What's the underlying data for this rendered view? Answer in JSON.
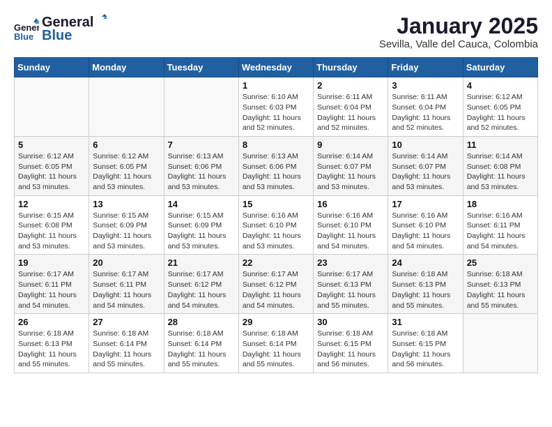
{
  "header": {
    "logo_line1": "General",
    "logo_line2": "Blue",
    "month": "January 2025",
    "location": "Sevilla, Valle del Cauca, Colombia"
  },
  "days_of_week": [
    "Sunday",
    "Monday",
    "Tuesday",
    "Wednesday",
    "Thursday",
    "Friday",
    "Saturday"
  ],
  "weeks": [
    [
      {
        "day": "",
        "info": ""
      },
      {
        "day": "",
        "info": ""
      },
      {
        "day": "",
        "info": ""
      },
      {
        "day": "1",
        "info": "Sunrise: 6:10 AM\nSunset: 6:03 PM\nDaylight: 11 hours\nand 52 minutes."
      },
      {
        "day": "2",
        "info": "Sunrise: 6:11 AM\nSunset: 6:04 PM\nDaylight: 11 hours\nand 52 minutes."
      },
      {
        "day": "3",
        "info": "Sunrise: 6:11 AM\nSunset: 6:04 PM\nDaylight: 11 hours\nand 52 minutes."
      },
      {
        "day": "4",
        "info": "Sunrise: 6:12 AM\nSunset: 6:05 PM\nDaylight: 11 hours\nand 52 minutes."
      }
    ],
    [
      {
        "day": "5",
        "info": "Sunrise: 6:12 AM\nSunset: 6:05 PM\nDaylight: 11 hours\nand 53 minutes."
      },
      {
        "day": "6",
        "info": "Sunrise: 6:12 AM\nSunset: 6:05 PM\nDaylight: 11 hours\nand 53 minutes."
      },
      {
        "day": "7",
        "info": "Sunrise: 6:13 AM\nSunset: 6:06 PM\nDaylight: 11 hours\nand 53 minutes."
      },
      {
        "day": "8",
        "info": "Sunrise: 6:13 AM\nSunset: 6:06 PM\nDaylight: 11 hours\nand 53 minutes."
      },
      {
        "day": "9",
        "info": "Sunrise: 6:14 AM\nSunset: 6:07 PM\nDaylight: 11 hours\nand 53 minutes."
      },
      {
        "day": "10",
        "info": "Sunrise: 6:14 AM\nSunset: 6:07 PM\nDaylight: 11 hours\nand 53 minutes."
      },
      {
        "day": "11",
        "info": "Sunrise: 6:14 AM\nSunset: 6:08 PM\nDaylight: 11 hours\nand 53 minutes."
      }
    ],
    [
      {
        "day": "12",
        "info": "Sunrise: 6:15 AM\nSunset: 6:08 PM\nDaylight: 11 hours\nand 53 minutes."
      },
      {
        "day": "13",
        "info": "Sunrise: 6:15 AM\nSunset: 6:09 PM\nDaylight: 11 hours\nand 53 minutes."
      },
      {
        "day": "14",
        "info": "Sunrise: 6:15 AM\nSunset: 6:09 PM\nDaylight: 11 hours\nand 53 minutes."
      },
      {
        "day": "15",
        "info": "Sunrise: 6:16 AM\nSunset: 6:10 PM\nDaylight: 11 hours\nand 53 minutes."
      },
      {
        "day": "16",
        "info": "Sunrise: 6:16 AM\nSunset: 6:10 PM\nDaylight: 11 hours\nand 54 minutes."
      },
      {
        "day": "17",
        "info": "Sunrise: 6:16 AM\nSunset: 6:10 PM\nDaylight: 11 hours\nand 54 minutes."
      },
      {
        "day": "18",
        "info": "Sunrise: 6:16 AM\nSunset: 6:11 PM\nDaylight: 11 hours\nand 54 minutes."
      }
    ],
    [
      {
        "day": "19",
        "info": "Sunrise: 6:17 AM\nSunset: 6:11 PM\nDaylight: 11 hours\nand 54 minutes."
      },
      {
        "day": "20",
        "info": "Sunrise: 6:17 AM\nSunset: 6:11 PM\nDaylight: 11 hours\nand 54 minutes."
      },
      {
        "day": "21",
        "info": "Sunrise: 6:17 AM\nSunset: 6:12 PM\nDaylight: 11 hours\nand 54 minutes."
      },
      {
        "day": "22",
        "info": "Sunrise: 6:17 AM\nSunset: 6:12 PM\nDaylight: 11 hours\nand 54 minutes."
      },
      {
        "day": "23",
        "info": "Sunrise: 6:17 AM\nSunset: 6:13 PM\nDaylight: 11 hours\nand 55 minutes."
      },
      {
        "day": "24",
        "info": "Sunrise: 6:18 AM\nSunset: 6:13 PM\nDaylight: 11 hours\nand 55 minutes."
      },
      {
        "day": "25",
        "info": "Sunrise: 6:18 AM\nSunset: 6:13 PM\nDaylight: 11 hours\nand 55 minutes."
      }
    ],
    [
      {
        "day": "26",
        "info": "Sunrise: 6:18 AM\nSunset: 6:13 PM\nDaylight: 11 hours\nand 55 minutes."
      },
      {
        "day": "27",
        "info": "Sunrise: 6:18 AM\nSunset: 6:14 PM\nDaylight: 11 hours\nand 55 minutes."
      },
      {
        "day": "28",
        "info": "Sunrise: 6:18 AM\nSunset: 6:14 PM\nDaylight: 11 hours\nand 55 minutes."
      },
      {
        "day": "29",
        "info": "Sunrise: 6:18 AM\nSunset: 6:14 PM\nDaylight: 11 hours\nand 55 minutes."
      },
      {
        "day": "30",
        "info": "Sunrise: 6:18 AM\nSunset: 6:15 PM\nDaylight: 11 hours\nand 56 minutes."
      },
      {
        "day": "31",
        "info": "Sunrise: 6:18 AM\nSunset: 6:15 PM\nDaylight: 11 hours\nand 56 minutes."
      },
      {
        "day": "",
        "info": ""
      }
    ]
  ]
}
